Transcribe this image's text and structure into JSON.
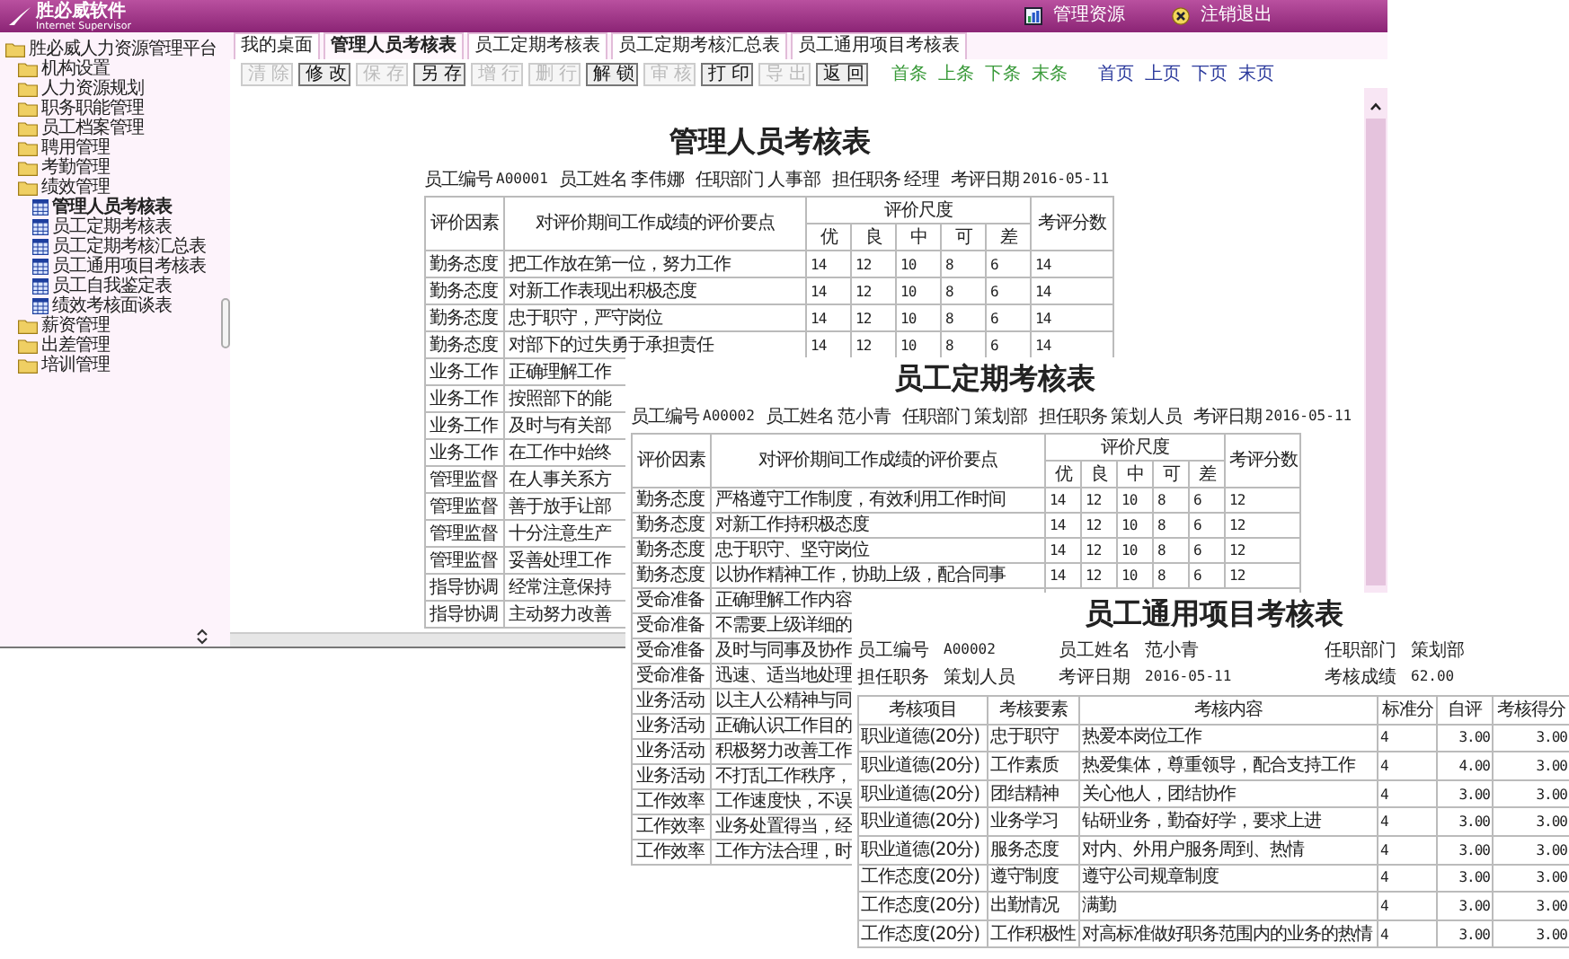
{
  "header": {
    "logo_title": "胜必威软件",
    "logo_subtitle": "Internet Supervisor",
    "links": [
      {
        "label": "管理资源",
        "kind": "resource"
      },
      {
        "label": "注销退出",
        "kind": "logout"
      }
    ]
  },
  "sidebar": {
    "items": [
      {
        "label": "胜必威人力资源管理平台",
        "kind": "folder",
        "selected": false,
        "children": [
          {
            "label": "机构设置",
            "kind": "folder",
            "selected": false
          },
          {
            "label": "人力资源规划",
            "kind": "folder",
            "selected": false
          },
          {
            "label": "职务职能管理",
            "kind": "folder",
            "selected": false
          },
          {
            "label": "员工档案管理",
            "kind": "folder",
            "selected": false
          },
          {
            "label": "聘用管理",
            "kind": "folder",
            "selected": false
          },
          {
            "label": "考勤管理",
            "kind": "folder",
            "selected": false
          },
          {
            "label": "绩效管理",
            "kind": "folder",
            "selected": false,
            "children": [
              {
                "label": "管理人员考核表",
                "kind": "form",
                "selected": true
              },
              {
                "label": "员工定期考核表",
                "kind": "form",
                "selected": false
              },
              {
                "label": "员工定期考核汇总表",
                "kind": "form",
                "selected": false
              },
              {
                "label": "员工通用项目考核表",
                "kind": "form",
                "selected": false
              },
              {
                "label": "员工自我鉴定表",
                "kind": "form",
                "selected": false
              },
              {
                "label": "绩效考核面谈表",
                "kind": "form",
                "selected": false
              }
            ]
          },
          {
            "label": "薪资管理",
            "kind": "folder",
            "selected": false
          },
          {
            "label": "出差管理",
            "kind": "folder",
            "selected": false
          },
          {
            "label": "培训管理",
            "kind": "folder",
            "selected": false
          }
        ]
      }
    ]
  },
  "tabs": [
    {
      "label": "我的桌面",
      "selected": false
    },
    {
      "label": "管理人员考核表",
      "selected": true
    },
    {
      "label": "员工定期考核表",
      "selected": false
    },
    {
      "label": "员工定期考核汇总表",
      "selected": false
    },
    {
      "label": "员工通用项目考核表",
      "selected": false
    }
  ],
  "toolbar": {
    "buttons": [
      {
        "label": "清除",
        "disabled": true
      },
      {
        "label": "修改",
        "disabled": false
      },
      {
        "label": "保存",
        "disabled": true
      },
      {
        "label": "另存",
        "disabled": false
      },
      {
        "label": "增行",
        "disabled": true
      },
      {
        "label": "删行",
        "disabled": true
      },
      {
        "label": "解锁",
        "disabled": false
      },
      {
        "label": "审核",
        "disabled": true
      },
      {
        "label": "打印",
        "disabled": false
      },
      {
        "label": "导出",
        "disabled": true
      },
      {
        "label": "返回",
        "disabled": false
      }
    ],
    "record_nav": [
      "首条",
      "上条",
      "下条",
      "末条"
    ],
    "page_nav": [
      "首页",
      "上页",
      "下页",
      "末页"
    ]
  },
  "documents": [
    {
      "kind": "rating",
      "title": "管理人员考核表",
      "fields": [
        {
          "label": "员工编号",
          "value": "A00001"
        },
        {
          "label": "员工姓名",
          "value": "李伟娜"
        },
        {
          "label": "任职部门",
          "value": "人事部"
        },
        {
          "label": "担任职务",
          "value": "经理"
        },
        {
          "label": "考评日期",
          "value": "2016-05-11"
        }
      ],
      "header": {
        "factor": "评价因素",
        "points": "对评价期间工作成绩的评价要点",
        "scale": "评价尺度",
        "grades": [
          "优",
          "良",
          "中",
          "可",
          "差"
        ],
        "score": "考评分数"
      },
      "rows": [
        {
          "factor": "勤务态度",
          "point": "把工作放在第一位，努力工作",
          "scores": [
            "14",
            "12",
            "10",
            "8",
            "6"
          ],
          "score": "14"
        },
        {
          "factor": "勤务态度",
          "point": "对新工作表现出积极态度",
          "scores": [
            "14",
            "12",
            "10",
            "8",
            "6"
          ],
          "score": "14"
        },
        {
          "factor": "勤务态度",
          "point": "忠于职守，严守岗位",
          "scores": [
            "14",
            "12",
            "10",
            "8",
            "6"
          ],
          "score": "14"
        },
        {
          "factor": "勤务态度",
          "point": "对部下的过失勇于承担责任",
          "scores": [
            "14",
            "12",
            "10",
            "8",
            "6"
          ],
          "score": "14"
        },
        {
          "factor": "业务工作",
          "point": "正确理解工作"
        },
        {
          "factor": "业务工作",
          "point": "按照部下的能"
        },
        {
          "factor": "业务工作",
          "point": "及时与有关部"
        },
        {
          "factor": "业务工作",
          "point": "在工作中始终"
        },
        {
          "factor": "管理监督",
          "point": "在人事关系方"
        },
        {
          "factor": "管理监督",
          "point": "善于放手让部"
        },
        {
          "factor": "管理监督",
          "point": "十分注意生产"
        },
        {
          "factor": "管理监督",
          "point": "妥善处理工作"
        },
        {
          "factor": "指导协调",
          "point": "经常注意保持"
        },
        {
          "factor": "指导协调",
          "point": "主动努力改善"
        }
      ]
    },
    {
      "kind": "rating",
      "title": "员工定期考核表",
      "fields": [
        {
          "label": "员工编号",
          "value": "A00002"
        },
        {
          "label": "员工姓名",
          "value": "范小青"
        },
        {
          "label": "任职部门",
          "value": "策划部"
        },
        {
          "label": "担任职务",
          "value": "策划人员"
        },
        {
          "label": "考评日期",
          "value": "2016-05-11"
        }
      ],
      "header": {
        "factor": "评价因素",
        "points": "对评价期间工作成绩的评价要点",
        "scale": "评价尺度",
        "grades": [
          "优",
          "良",
          "中",
          "可",
          "差"
        ],
        "score": "考评分数"
      },
      "rows": [
        {
          "factor": "勤务态度",
          "point": "严格遵守工作制度，有效利用工作时间",
          "scores": [
            "14",
            "12",
            "10",
            "8",
            "6"
          ],
          "score": "12"
        },
        {
          "factor": "勤务态度",
          "point": "对新工作持积极态度",
          "scores": [
            "14",
            "12",
            "10",
            "8",
            "6"
          ],
          "score": "12"
        },
        {
          "factor": "勤务态度",
          "point": "忠于职守、坚守岗位",
          "scores": [
            "14",
            "12",
            "10",
            "8",
            "6"
          ],
          "score": "12"
        },
        {
          "factor": "勤务态度",
          "point": "以协作精神工作，协助上级，配合同事",
          "scores": [
            "14",
            "12",
            "10",
            "8",
            "6"
          ],
          "score": "12"
        },
        {
          "factor": "受命准备",
          "point": "正确理解工作内容"
        },
        {
          "factor": "受命准备",
          "point": "不需要上级详细的"
        },
        {
          "factor": "受命准备",
          "point": "及时与同事及协作"
        },
        {
          "factor": "受命准备",
          "point": "迅速、适当地处理"
        },
        {
          "factor": "业务活动",
          "point": "以主人公精神与同"
        },
        {
          "factor": "业务活动",
          "point": "正确认识工作目的"
        },
        {
          "factor": "业务活动",
          "point": "积极努力改善工作"
        },
        {
          "factor": "业务活动",
          "point": "不打乱工作秩序，"
        },
        {
          "factor": "工作效率",
          "point": "工作速度快，不误"
        },
        {
          "factor": "工作效率",
          "point": "业务处置得当，经"
        },
        {
          "factor": "工作效率",
          "point": "工作方法合理，时"
        }
      ]
    },
    {
      "kind": "project",
      "title": "员工通用项目考核表",
      "fields": [
        {
          "label": "员工编号",
          "value": "A00002"
        },
        {
          "label": "员工姓名",
          "value": "范小青"
        },
        {
          "label": "任职部门",
          "value": "策划部"
        },
        {
          "label": "担任职务",
          "value": "策划人员"
        },
        {
          "label": "考评日期",
          "value": "2016-05-11"
        },
        {
          "label": "考核成绩",
          "value": "62.00"
        }
      ],
      "columns": [
        "考核项目",
        "考核要素",
        "考核内容",
        "标准分",
        "自评",
        "考核得分"
      ],
      "rows": [
        [
          "职业道德(20分)",
          "忠于职守",
          "热爱本岗位工作",
          "4",
          "3.00",
          "3.00"
        ],
        [
          "职业道德(20分)",
          "工作素质",
          "热爱集体，尊重领导，配合支持工作",
          "4",
          "4.00",
          "3.00"
        ],
        [
          "职业道德(20分)",
          "团结精神",
          "关心他人，团结协作",
          "4",
          "3.00",
          "3.00"
        ],
        [
          "职业道德(20分)",
          "业务学习",
          "钻研业务，勤奋好学，要求上进",
          "4",
          "3.00",
          "3.00"
        ],
        [
          "职业道德(20分)",
          "服务态度",
          "对内、外用户服务周到、热情",
          "4",
          "3.00",
          "3.00"
        ],
        [
          "工作态度(20分)",
          "遵守制度",
          "遵守公司规章制度",
          "4",
          "3.00",
          "3.00"
        ],
        [
          "工作态度(20分)",
          "出勤情况",
          "满勤",
          "4",
          "3.00",
          "3.00"
        ],
        [
          "工作态度(20分)",
          "工作积极性",
          "对高标准做好职务范围内的业务的热情",
          "4",
          "3.00",
          "3.00"
        ]
      ]
    }
  ]
}
